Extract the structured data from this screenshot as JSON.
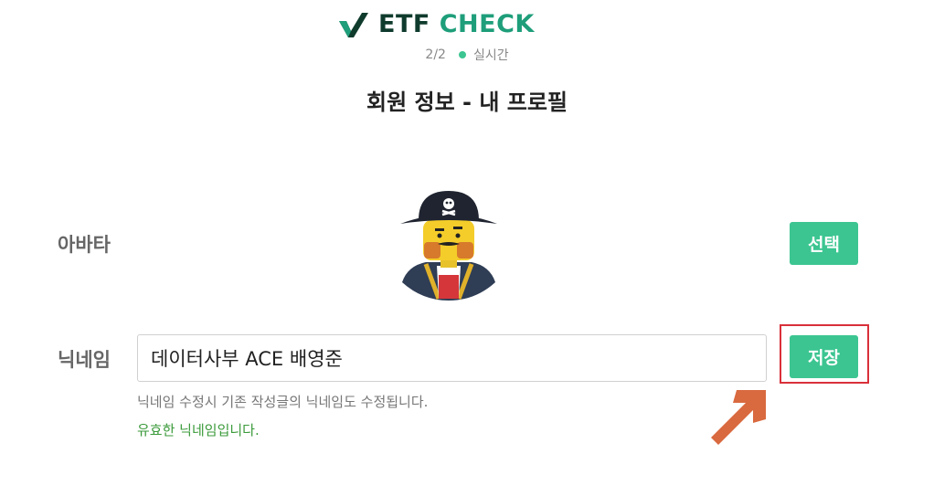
{
  "brand": {
    "logo_etf": "ETF",
    "logo_check": "CHECK",
    "logo_icon": "checkmark-icon"
  },
  "header": {
    "step": "2/2",
    "live_label": "실시간",
    "title": "회원 정보 - 내 프로필"
  },
  "avatar_row": {
    "label": "아바타",
    "select_button": "선택",
    "avatar_icon": "pirate-avatar-icon"
  },
  "nickname_row": {
    "label": "닉네임",
    "value": "데이터사부 ACE 배영준",
    "save_button": "저장",
    "help_text": "닉네임 수정시 기존 작성글의 닉네임도 수정됩니다.",
    "valid_text": "유효한 닉네임입니다."
  },
  "colors": {
    "accent": "#3cc591",
    "brand_dark": "#0f3b2d",
    "brand_green": "#1e9e7a",
    "highlight": "#d9303a",
    "arrow": "#d9693f",
    "valid": "#3a9a3a"
  }
}
